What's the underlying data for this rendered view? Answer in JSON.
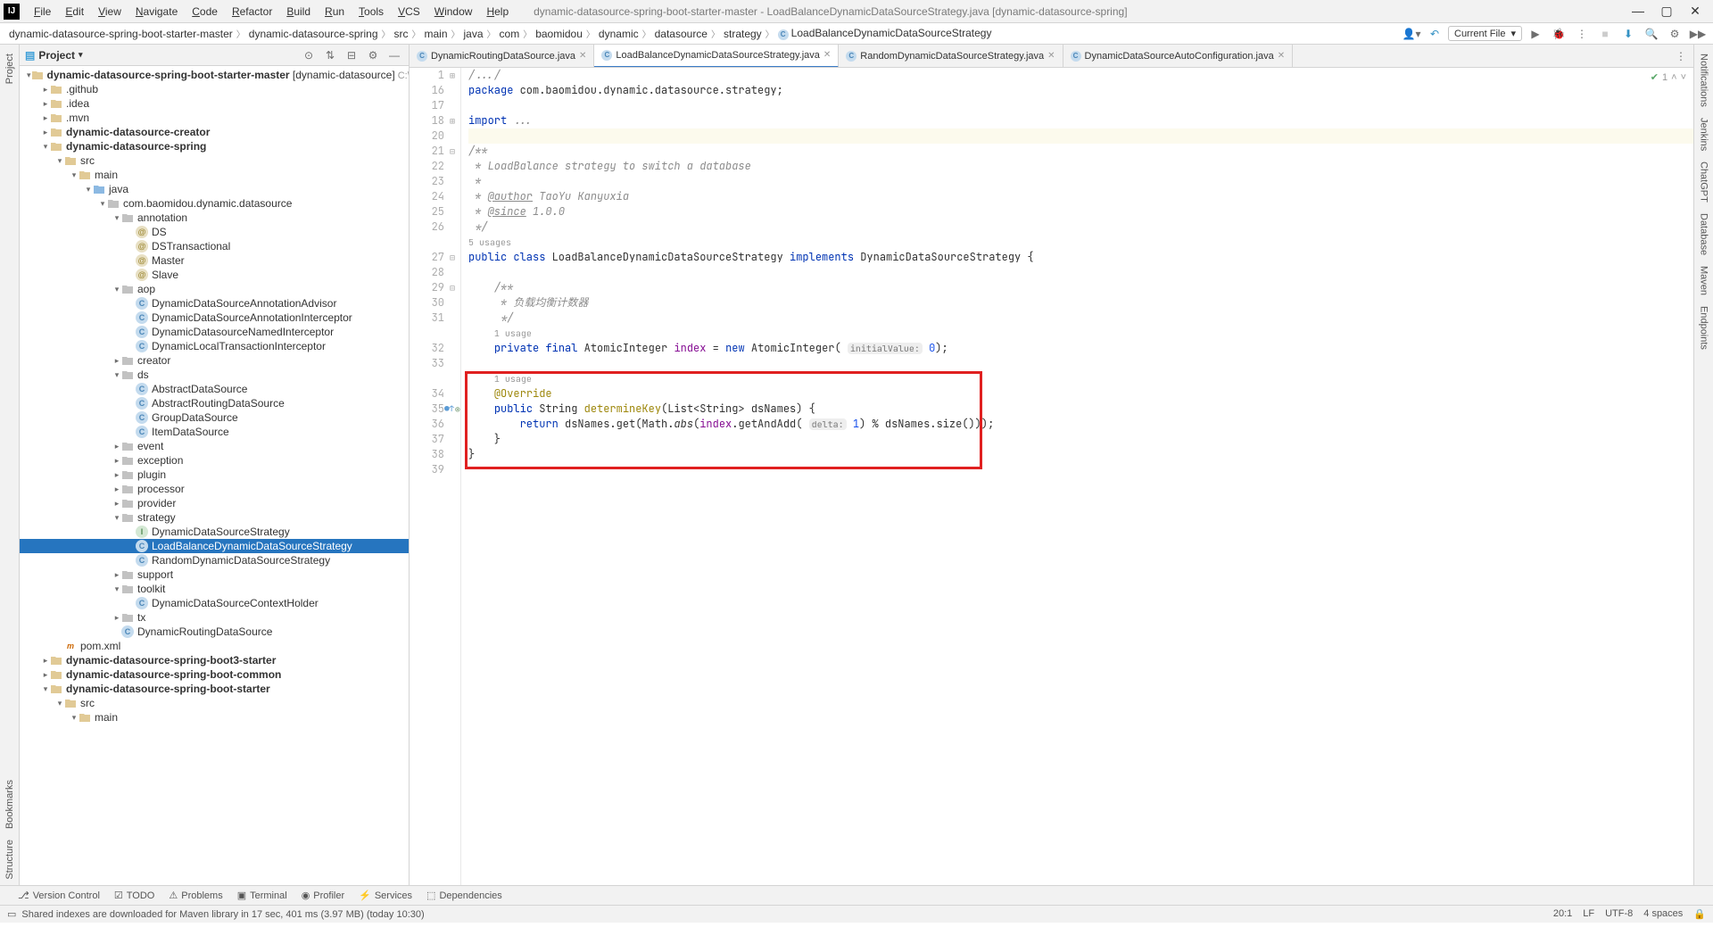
{
  "window": {
    "title": "dynamic-datasource-spring-boot-starter-master - LoadBalanceDynamicDataSourceStrategy.java [dynamic-datasource-spring]"
  },
  "menu": {
    "items": [
      "File",
      "Edit",
      "View",
      "Navigate",
      "Code",
      "Refactor",
      "Build",
      "Run",
      "Tools",
      "VCS",
      "Window",
      "Help"
    ]
  },
  "breadcrumbs": [
    "dynamic-datasource-spring-boot-starter-master",
    "dynamic-datasource-spring",
    "src",
    "main",
    "java",
    "com",
    "baomidou",
    "dynamic",
    "datasource",
    "strategy",
    "LoadBalanceDynamicDataSourceStrategy"
  ],
  "run_config": {
    "current_file": "Current File"
  },
  "project_panel": {
    "title": "Project"
  },
  "tree": [
    {
      "depth": 0,
      "chev": "down",
      "icon": "folder",
      "label": "dynamic-datasource-spring-boot-starter-master",
      "bold": true,
      "suffix": " [dynamic-datasource]",
      "gray": "  C:\\Users"
    },
    {
      "depth": 1,
      "chev": "right",
      "icon": "folder",
      "label": ".github"
    },
    {
      "depth": 1,
      "chev": "right",
      "icon": "folder",
      "label": ".idea"
    },
    {
      "depth": 1,
      "chev": "right",
      "icon": "folder",
      "label": ".mvn"
    },
    {
      "depth": 1,
      "chev": "right",
      "icon": "module",
      "label": "dynamic-datasource-creator",
      "bold": true
    },
    {
      "depth": 1,
      "chev": "down",
      "icon": "module",
      "label": "dynamic-datasource-spring",
      "bold": true
    },
    {
      "depth": 2,
      "chev": "down",
      "icon": "folder",
      "label": "src"
    },
    {
      "depth": 3,
      "chev": "down",
      "icon": "folder",
      "label": "main"
    },
    {
      "depth": 4,
      "chev": "down",
      "icon": "src-folder",
      "label": "java"
    },
    {
      "depth": 5,
      "chev": "down",
      "icon": "package",
      "label": "com.baomidou.dynamic.datasource"
    },
    {
      "depth": 6,
      "chev": "down",
      "icon": "package",
      "label": "annotation"
    },
    {
      "depth": 7,
      "chev": "",
      "icon": "anno",
      "label": "DS"
    },
    {
      "depth": 7,
      "chev": "",
      "icon": "anno",
      "label": "DSTransactional"
    },
    {
      "depth": 7,
      "chev": "",
      "icon": "anno",
      "label": "Master"
    },
    {
      "depth": 7,
      "chev": "",
      "icon": "anno",
      "label": "Slave"
    },
    {
      "depth": 6,
      "chev": "down",
      "icon": "package",
      "label": "aop"
    },
    {
      "depth": 7,
      "chev": "",
      "icon": "class",
      "label": "DynamicDataSourceAnnotationAdvisor"
    },
    {
      "depth": 7,
      "chev": "",
      "icon": "class",
      "label": "DynamicDataSourceAnnotationInterceptor"
    },
    {
      "depth": 7,
      "chev": "",
      "icon": "class",
      "label": "DynamicDatasourceNamedInterceptor"
    },
    {
      "depth": 7,
      "chev": "",
      "icon": "class",
      "label": "DynamicLocalTransactionInterceptor"
    },
    {
      "depth": 6,
      "chev": "right",
      "icon": "package",
      "label": "creator"
    },
    {
      "depth": 6,
      "chev": "down",
      "icon": "package",
      "label": "ds"
    },
    {
      "depth": 7,
      "chev": "",
      "icon": "class",
      "label": "AbstractDataSource"
    },
    {
      "depth": 7,
      "chev": "",
      "icon": "class",
      "label": "AbstractRoutingDataSource"
    },
    {
      "depth": 7,
      "chev": "",
      "icon": "class",
      "label": "GroupDataSource"
    },
    {
      "depth": 7,
      "chev": "",
      "icon": "class",
      "label": "ItemDataSource"
    },
    {
      "depth": 6,
      "chev": "right",
      "icon": "package",
      "label": "event"
    },
    {
      "depth": 6,
      "chev": "right",
      "icon": "package",
      "label": "exception"
    },
    {
      "depth": 6,
      "chev": "right",
      "icon": "package",
      "label": "plugin"
    },
    {
      "depth": 6,
      "chev": "right",
      "icon": "package",
      "label": "processor"
    },
    {
      "depth": 6,
      "chev": "right",
      "icon": "package",
      "label": "provider"
    },
    {
      "depth": 6,
      "chev": "down",
      "icon": "package",
      "label": "strategy"
    },
    {
      "depth": 7,
      "chev": "",
      "icon": "interface",
      "label": "DynamicDataSourceStrategy"
    },
    {
      "depth": 7,
      "chev": "",
      "icon": "class",
      "label": "LoadBalanceDynamicDataSourceStrategy",
      "selected": true
    },
    {
      "depth": 7,
      "chev": "",
      "icon": "class",
      "label": "RandomDynamicDataSourceStrategy"
    },
    {
      "depth": 6,
      "chev": "right",
      "icon": "package",
      "label": "support"
    },
    {
      "depth": 6,
      "chev": "down",
      "icon": "package",
      "label": "toolkit"
    },
    {
      "depth": 7,
      "chev": "",
      "icon": "class",
      "label": "DynamicDataSourceContextHolder"
    },
    {
      "depth": 6,
      "chev": "right",
      "icon": "package",
      "label": "tx"
    },
    {
      "depth": 6,
      "chev": "",
      "icon": "class",
      "label": "DynamicRoutingDataSource"
    },
    {
      "depth": 2,
      "chev": "",
      "icon": "maven",
      "label": "pom.xml"
    },
    {
      "depth": 1,
      "chev": "right",
      "icon": "module",
      "label": "dynamic-datasource-spring-boot3-starter",
      "bold": true
    },
    {
      "depth": 1,
      "chev": "right",
      "icon": "module",
      "label": "dynamic-datasource-spring-boot-common",
      "bold": true
    },
    {
      "depth": 1,
      "chev": "down",
      "icon": "module",
      "label": "dynamic-datasource-spring-boot-starter",
      "bold": true
    },
    {
      "depth": 2,
      "chev": "down",
      "icon": "folder",
      "label": "src"
    },
    {
      "depth": 3,
      "chev": "down",
      "icon": "folder",
      "label": "main"
    }
  ],
  "editor_tabs": [
    {
      "label": "DynamicRoutingDataSource.java",
      "active": false
    },
    {
      "label": "LoadBalanceDynamicDataSourceStrategy.java",
      "active": true
    },
    {
      "label": "RandomDynamicDataSourceStrategy.java",
      "active": false
    },
    {
      "label": "DynamicDataSourceAutoConfiguration.java",
      "active": false
    }
  ],
  "code": {
    "lines": [
      {
        "n": 1,
        "html": "<span class='cmt'>/.../</span>",
        "fold": "+"
      },
      {
        "n": 16,
        "html": "<span class='kw'>package</span> com.baomidou.dynamic.datasource.strategy;"
      },
      {
        "n": 17,
        "html": ""
      },
      {
        "n": 18,
        "html": "<span class='kw'>import</span> <span class='cmt'>...</span>",
        "fold": "+"
      },
      {
        "n": 20,
        "html": "",
        "caret": true
      },
      {
        "n": 21,
        "html": "<span class='cmt'>/**</span>",
        "fold": "-"
      },
      {
        "n": 22,
        "html": "<span class='cmt'> * LoadBalance strategy to switch a database</span>"
      },
      {
        "n": 23,
        "html": "<span class='cmt'> *</span>"
      },
      {
        "n": 24,
        "html": "<span class='cmt'> * <span class='doc-tag'>@author</span> TaoYu Kanyuxia</span>"
      },
      {
        "n": 25,
        "html": "<span class='cmt'> * <span class='doc-tag'>@since</span> 1.0.0</span>"
      },
      {
        "n": 26,
        "html": "<span class='cmt'> */</span>"
      },
      {
        "n": "",
        "html": "<span class='usage-hint'>5 usages</span>"
      },
      {
        "n": 27,
        "html": "<span class='kw'>public class</span> LoadBalanceDynamicDataSourceStrategy <span class='kw'>implements</span> DynamicDataSourceStrategy {",
        "fold": "-"
      },
      {
        "n": 28,
        "html": ""
      },
      {
        "n": 29,
        "html": "    <span class='cmt'>/**</span>",
        "fold": "-"
      },
      {
        "n": 30,
        "html": "    <span class='cmt'> * 负载均衡计数器</span>"
      },
      {
        "n": 31,
        "html": "    <span class='cmt'> */</span>"
      },
      {
        "n": "",
        "html": "    <span class='usage-hint'>1 usage</span>"
      },
      {
        "n": 32,
        "html": "    <span class='kw'>private final</span> AtomicInteger <span class='field'>index</span> = <span class='kw'>new</span> AtomicInteger( <span class='param-hint'>initialValue:</span> <span class='num'>0</span>);"
      },
      {
        "n": 33,
        "html": ""
      },
      {
        "n": "",
        "html": "    <span class='usage-hint'>1 usage</span>"
      },
      {
        "n": 34,
        "html": "    <span class='ann'>@Override</span>"
      },
      {
        "n": 35,
        "html": "    <span class='kw'>public</span> String <span class='ann'>determineKey</span>(List&lt;String&gt; dsNames) {",
        "fold": "-",
        "override": true
      },
      {
        "n": 36,
        "html": "        <span class='kw'>return</span> dsNames.get(Math.<span style='font-style:italic'>abs</span>(<span class='field'>index</span>.getAndAdd( <span class='param-hint'>delta:</span> <span class='num'>1</span>) % dsNames.size()));"
      },
      {
        "n": 37,
        "html": "    }"
      },
      {
        "n": 38,
        "html": "}"
      },
      {
        "n": 39,
        "html": ""
      }
    ]
  },
  "inspector": {
    "warnings": "1"
  },
  "bottom_tabs": [
    "Version Control",
    "TODO",
    "Problems",
    "Terminal",
    "Profiler",
    "Services",
    "Dependencies"
  ],
  "status": {
    "message": "Shared indexes are downloaded for Maven library in 17 sec, 401 ms (3.97 MB) (today 10:30)",
    "right": [
      "20:1",
      "LF",
      "UTF-8",
      "4 spaces"
    ]
  },
  "right_tools": [
    "Notifications",
    "Jenkins",
    "ChatGPT",
    "Database",
    "Maven",
    "Endpoints"
  ],
  "left_tools": [
    "Project",
    "Bookmarks",
    "Structure"
  ]
}
